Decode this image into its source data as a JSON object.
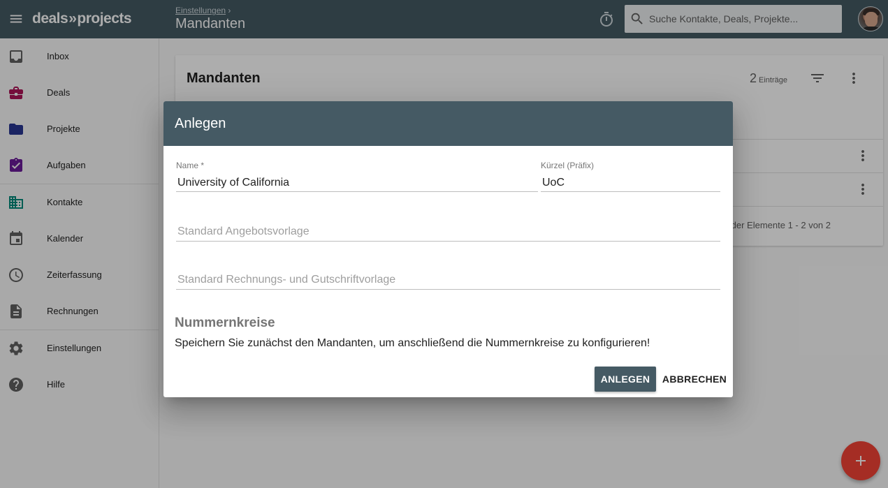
{
  "app": {
    "logo_left": "deals",
    "logo_sep": "»",
    "logo_right": "projects"
  },
  "header": {
    "breadcrumb": "Einstellungen",
    "breadcrumb_sep": "›",
    "title": "Mandanten",
    "search_placeholder": "Suche Kontakte, Deals, Projekte..."
  },
  "sidebar": {
    "items": [
      {
        "label": "Inbox",
        "icon": "inbox-icon",
        "color": "#616161"
      },
      {
        "label": "Deals",
        "icon": "briefcase-icon",
        "color": "#ad1457"
      },
      {
        "label": "Projekte",
        "icon": "folder-icon",
        "color": "#283593"
      },
      {
        "label": "Aufgaben",
        "icon": "clipboard-check-icon",
        "color": "#6a1b9a"
      },
      {
        "label": "Kontakte",
        "icon": "building-icon",
        "color": "#00897b"
      },
      {
        "label": "Kalender",
        "icon": "calendar-icon",
        "color": "#616161"
      },
      {
        "label": "Zeiterfassung",
        "icon": "clock-icon",
        "color": "#616161"
      },
      {
        "label": "Rechnungen",
        "icon": "document-icon",
        "color": "#616161"
      },
      {
        "label": "Einstellungen",
        "icon": "gear-icon",
        "color": "#616161"
      },
      {
        "label": "Hilfe",
        "icon": "help-icon",
        "color": "#616161"
      }
    ]
  },
  "card": {
    "title": "Mandanten",
    "count": "2",
    "count_label": "Einträge",
    "pager": "der Elemente 1 - 2 von 2"
  },
  "dialog": {
    "title": "Anlegen",
    "name_label": "Name *",
    "name_value": "University of California",
    "prefix_label": "Kürzel (Präfix)",
    "prefix_value": "UoC",
    "offer_template_placeholder": "Standard Angebotsvorlage",
    "invoice_template_placeholder": "Standard Rechnungs- und Gutschriftvorlage",
    "section_title": "Nummernkreise",
    "section_text": "Speichern Sie zunächst den Mandanten, um anschließend die Nummernkreise zu konfigurieren!",
    "create_button": "ANLEGEN",
    "cancel_button": "ABBRECHEN"
  },
  "colors": {
    "primary": "#455a64",
    "fab": "#f44336"
  }
}
